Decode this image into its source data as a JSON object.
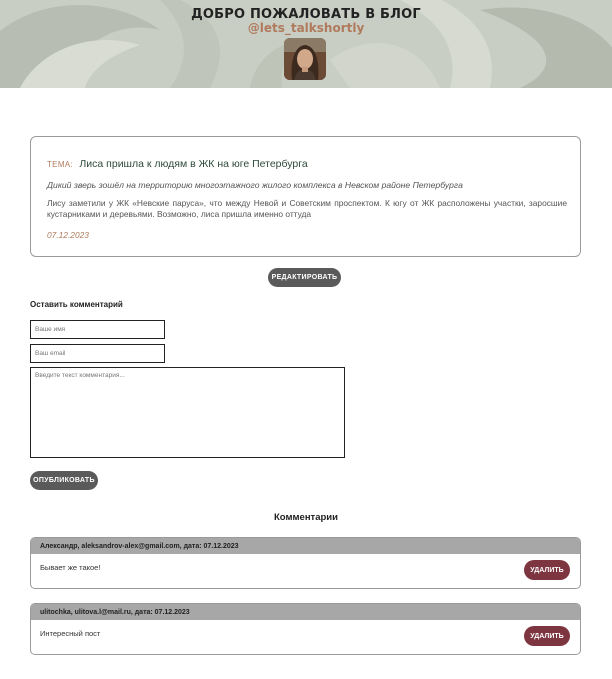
{
  "header": {
    "title": "ДОБРО ПОЖАЛОВАТЬ В БЛОГ",
    "handle": "@lets_talkshortly"
  },
  "post": {
    "topic_label": "ТЕМА:",
    "title": "Лиса пришла к людям в ЖК на юге Петербурга",
    "lead": "Дикий зверь зошёл на территорию многоэтажного жилого комплекса в Невском районе Петербурга",
    "body": "Лису заметили у ЖК «Невские паруса», что между Невой и Советским проспектом. К югу от ЖК расположены участки, заросшие кустарниками и деревьями. Возможно, лиса пришла именно оттуда",
    "date": "07.12.2023",
    "edit_label": "РЕДАКТИРОВАТЬ"
  },
  "comment_form": {
    "title": "Оставить комментарий",
    "name_placeholder": "Ваше имя",
    "email_placeholder": "Ваш email",
    "text_placeholder": "Введите текст комментария...",
    "publish_label": "ОПУБЛИКОВАТЬ"
  },
  "comments": {
    "heading": "Комментарии",
    "items": [
      {
        "header": "Александр,  aleksandrov-alex@gmail.com,  дата: 07.12.2023",
        "text": "Бывает же такое!",
        "delete_label": "УДАЛИТЬ"
      },
      {
        "header": "ulitochka,  ulitova.l@mail.ru,  дата: 07.12.2023",
        "text": "Интересный пост",
        "delete_label": "УДАЛИТЬ"
      }
    ]
  },
  "colors": {
    "accent": "#b07a5d",
    "button_dark": "#5a5a5a",
    "delete_button": "#7d3540",
    "comment_header": "#a7a7a7"
  }
}
